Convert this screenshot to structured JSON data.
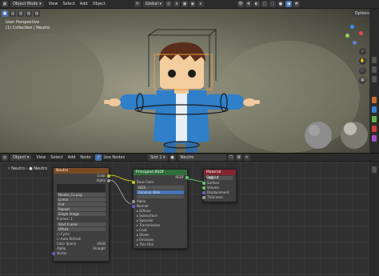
{
  "header": {
    "mode": "Object Mode",
    "menus": [
      "View",
      "Select",
      "Add",
      "Object"
    ],
    "transform": "Global",
    "options": "Options"
  },
  "viewport": {
    "overlay_line1": "User Perspective",
    "overlay_line2": "(1) Collection | Neutro"
  },
  "node_header": {
    "editor": "Object",
    "menus": [
      "View",
      "Select",
      "Add",
      "Node"
    ],
    "use_nodes": "Use Nodes",
    "slot": "Slot 1",
    "material": "Neutro"
  },
  "breadcrumb": {
    "object": "Neutro",
    "material": "Neutro"
  },
  "nodes": {
    "image": {
      "title": "Neutro",
      "outputs": [
        "Color",
        "Alpha"
      ],
      "rows": [
        "Neutro_Co.png",
        "Linear",
        "Flat",
        "Repeat",
        "Single Image"
      ],
      "frames_label": "Frames:",
      "frames": "1",
      "start": "Start Frame:",
      "offset": "Offset:",
      "cyclic": "Cyclic",
      "auto_refresh": "Auto Refresh",
      "color_space_label": "Color Space",
      "color_space": "sRGB",
      "alpha_label": "Alpha",
      "alpha": "Straight",
      "vector": "Vector"
    },
    "bsdf": {
      "title": "Principled BSDF",
      "output": "BSDF",
      "method": "GGX",
      "sss": "Random Walk",
      "base_color": "Base Color",
      "inputs": [
        "Alpha",
        "Normal"
      ],
      "panels": [
        "Subsurface",
        "Specular",
        "Transmission",
        "Coat",
        "Sheen",
        "Emission",
        "Thin Film"
      ],
      "diffuse": "Diffuse"
    },
    "output": {
      "title": "Material Output",
      "target": "All",
      "inputs": [
        "Surface",
        "Volume",
        "Displacement",
        "Thickness"
      ]
    }
  },
  "colors": {
    "accent": "#4772b3",
    "image_header": "#7a4a23",
    "shader_header": "#2f6f3c",
    "output_header": "#822730",
    "socket_color": "#c7c729",
    "socket_shader": "#63c763",
    "socket_vector": "#6363c7"
  }
}
